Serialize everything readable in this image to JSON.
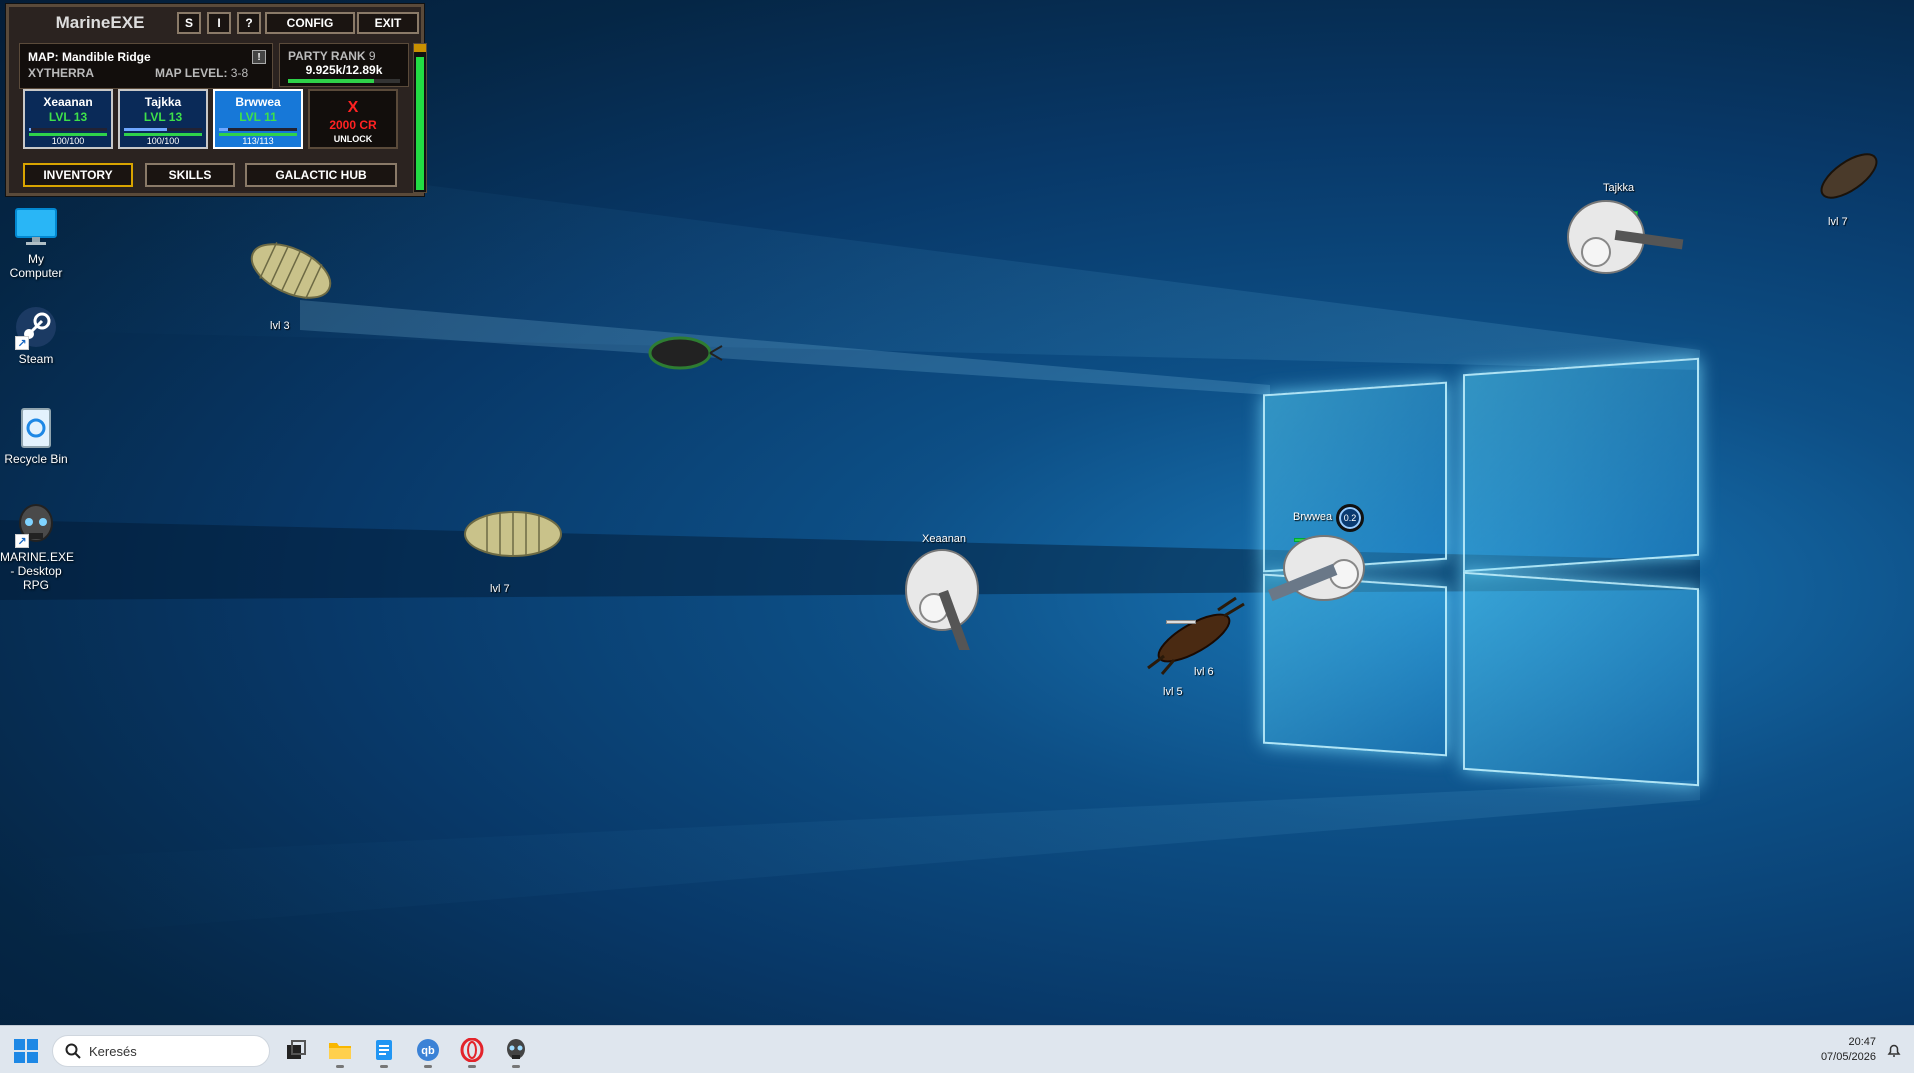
{
  "hud": {
    "title": "MarineEXE",
    "buttons": {
      "s": "S",
      "i": "I",
      "help": "?",
      "config": "CONFIG",
      "exit": "EXIT"
    },
    "map": {
      "name": "MAP: Mandible Ridge",
      "zone": "XYTHERRA",
      "level_label": "MAP LEVEL:",
      "level_value": "3-8",
      "alert": "!"
    },
    "rank": {
      "label": "PARTY RANK",
      "value": "9",
      "xp": "9.925k/12.89k",
      "progress": 0.77
    },
    "side_gauge": 0.9,
    "party": [
      {
        "name": "Xeaanan",
        "level": "LVL 13",
        "hp": "100/100",
        "xp_progress": 0.02,
        "hp_progress": 1.0
      },
      {
        "name": "Tajkka",
        "level": "LVL 13",
        "hp": "100/100",
        "xp_progress": 0.55,
        "hp_progress": 1.0
      },
      {
        "name": "Brwwea",
        "level": "LVL 11",
        "hp": "113/113",
        "xp_progress": 0.12,
        "hp_progress": 1.0
      }
    ],
    "locked_slot": {
      "mark": "X",
      "cost": "2000 CR",
      "label": "UNLOCK"
    },
    "menu": {
      "inventory": "INVENTORY",
      "skills": "SKILLS",
      "hub": "GALACTIC HUB"
    }
  },
  "desktop_icons": [
    {
      "label": "My Computer",
      "icon": "monitor-icon"
    },
    {
      "label": "Steam",
      "icon": "steam-icon"
    },
    {
      "label": "Recycle Bin",
      "icon": "recycle-bin-icon"
    },
    {
      "label": "MARINE.EXE - Desktop RPG",
      "icon": "marine-skull-icon"
    }
  ],
  "game": {
    "enemies": [
      {
        "label": "lvl 3"
      },
      {
        "label": "lvl 7"
      },
      {
        "label": "lvl 7"
      },
      {
        "label": "lvl 6"
      },
      {
        "label": "lvl 5"
      }
    ],
    "marines": [
      {
        "name": "Tajkka"
      },
      {
        "name": "Xeaanan"
      },
      {
        "name": "Brwwea",
        "cooldown": "0.2"
      }
    ]
  },
  "taskbar": {
    "search_placeholder": "Keresés",
    "time": "20:47",
    "date": "07/05/2026"
  },
  "colors": {
    "accent_green": "#2fd24a",
    "selected_blue": "#1778d8",
    "lock_red": "#ff2222",
    "hud_bg": "#2b2320"
  }
}
